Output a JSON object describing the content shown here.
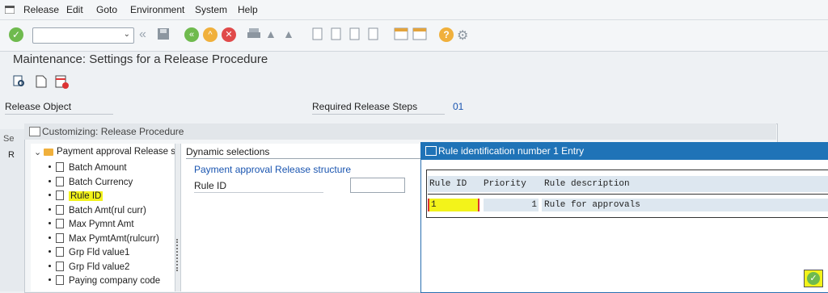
{
  "menubar": {
    "items": [
      "Release",
      "Edit",
      "Goto",
      "Environment",
      "System",
      "Help"
    ]
  },
  "toolbar": {
    "command_value": ""
  },
  "page": {
    "title": "Maintenance: Settings for a Release Procedure"
  },
  "release": {
    "object_label": "Release Object",
    "steps_label": "Required Release Steps",
    "steps_value": "01",
    "left_col_header": "Se",
    "left_col_row": "R"
  },
  "customizing": {
    "title": "Customizing: Release Procedure",
    "root": "Payment approval Release stru",
    "items": [
      "Batch Amount",
      "Batch Currency",
      "Rule ID",
      "Batch Amt(rul curr)",
      "Max Pymnt Amt",
      "Max PymtAmt(rulcurr)",
      "Grp Fld value1",
      "Grp Fld value2",
      "Paying company code"
    ]
  },
  "dynamic": {
    "tab": "Dynamic selections",
    "structure": "Payment approval Release structure",
    "field_label": "Rule ID",
    "field_value": ""
  },
  "rule_dialog": {
    "title": "Rule identification number 1 Entry",
    "columns": [
      "Rule ID",
      "Priority",
      "Rule description"
    ],
    "row": {
      "rule_id": "1",
      "priority": "1",
      "description": "Rule for approvals"
    }
  },
  "colors": {
    "accent": "#1f73b7",
    "highlight": "#f3f31a",
    "link": "#1a55b0"
  },
  "icons": [
    "checkmark-icon",
    "save-icon",
    "back-icon",
    "exit-icon",
    "cancel-icon",
    "print-icon",
    "find-icon",
    "help-icon",
    "settings-icon",
    "confirm-icon"
  ]
}
